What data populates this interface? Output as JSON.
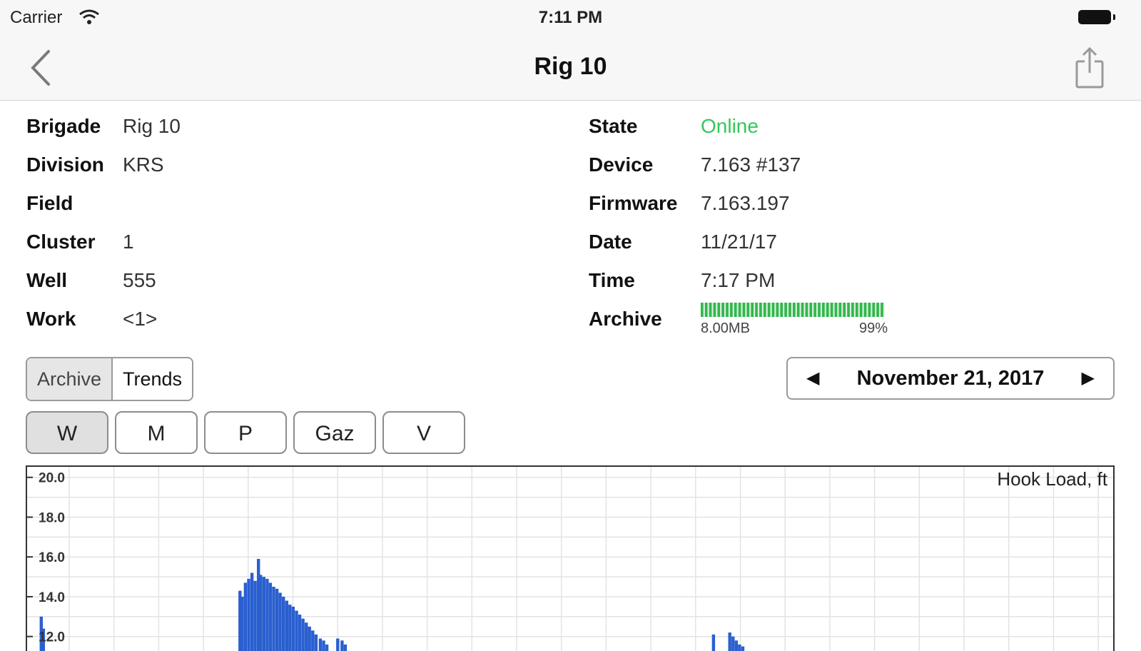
{
  "status_bar": {
    "carrier": "Carrier",
    "time": "7:11 PM",
    "icons": [
      "wifi-icon",
      "battery-icon"
    ]
  },
  "nav": {
    "title": "Rig 10",
    "icons": [
      "chevron-left-icon",
      "share-icon"
    ]
  },
  "info_left": [
    {
      "label": "Brigade",
      "value": "Rig 10"
    },
    {
      "label": "Division",
      "value": "KRS"
    },
    {
      "label": "Field",
      "value": ""
    },
    {
      "label": "Cluster",
      "value": "1"
    },
    {
      "label": "Well",
      "value": "555"
    },
    {
      "label": "Work",
      "value": "<1>"
    }
  ],
  "info_right": [
    {
      "label": "State",
      "value": "Online"
    },
    {
      "label": "Device",
      "value": "7.163 #137"
    },
    {
      "label": "Firmware",
      "value": "7.163.197"
    },
    {
      "label": "Date",
      "value": "11/21/17"
    },
    {
      "label": "Time",
      "value": "7:17 PM"
    },
    {
      "label": "Archive",
      "value": ""
    }
  ],
  "archive": {
    "size": "8.00MB",
    "percent_label": "99%",
    "fill_fraction": 0.99
  },
  "colors": {
    "online": "#34c759",
    "archive_bar": "#2fb84a",
    "series": "#2a5fd0"
  },
  "mode_segment": [
    "Archive",
    "Trends"
  ],
  "date_picker": {
    "date": "November 21, 2017",
    "prev": "◀",
    "next": "▶"
  },
  "filters": [
    "W",
    "M",
    "P",
    "Gaz",
    "V"
  ],
  "chart_data": {
    "type": "bar",
    "title": "Hook Load, ft",
    "ylim": [
      11.2,
      20.6
    ],
    "yticks": [
      "20.0",
      "18.0",
      "16.0",
      "14.0",
      "12.0"
    ],
    "grid": true,
    "x_range": [
      0,
      100
    ],
    "bars": [
      {
        "x": 1.3,
        "y": 13.0
      },
      {
        "x": 1.5,
        "y": 12.4
      },
      {
        "x": 19.6,
        "y": 14.3
      },
      {
        "x": 19.8,
        "y": 14.0
      },
      {
        "x": 20.1,
        "y": 14.7
      },
      {
        "x": 20.4,
        "y": 14.9
      },
      {
        "x": 20.7,
        "y": 15.2
      },
      {
        "x": 21.0,
        "y": 14.8
      },
      {
        "x": 21.3,
        "y": 15.9
      },
      {
        "x": 21.5,
        "y": 15.1
      },
      {
        "x": 21.8,
        "y": 15.0
      },
      {
        "x": 22.1,
        "y": 14.9
      },
      {
        "x": 22.4,
        "y": 14.7
      },
      {
        "x": 22.7,
        "y": 14.5
      },
      {
        "x": 23.0,
        "y": 14.4
      },
      {
        "x": 23.3,
        "y": 14.2
      },
      {
        "x": 23.6,
        "y": 14.0
      },
      {
        "x": 23.9,
        "y": 13.8
      },
      {
        "x": 24.2,
        "y": 13.6
      },
      {
        "x": 24.5,
        "y": 13.5
      },
      {
        "x": 24.8,
        "y": 13.3
      },
      {
        "x": 25.1,
        "y": 13.1
      },
      {
        "x": 25.4,
        "y": 12.9
      },
      {
        "x": 25.7,
        "y": 12.7
      },
      {
        "x": 26.0,
        "y": 12.5
      },
      {
        "x": 26.3,
        "y": 12.3
      },
      {
        "x": 26.6,
        "y": 12.1
      },
      {
        "x": 27.0,
        "y": 11.9
      },
      {
        "x": 27.3,
        "y": 11.8
      },
      {
        "x": 27.6,
        "y": 11.6
      },
      {
        "x": 28.6,
        "y": 11.9
      },
      {
        "x": 29.0,
        "y": 11.8
      },
      {
        "x": 29.3,
        "y": 11.6
      },
      {
        "x": 63.2,
        "y": 12.1
      },
      {
        "x": 64.7,
        "y": 12.2
      },
      {
        "x": 65.0,
        "y": 12.0
      },
      {
        "x": 65.3,
        "y": 11.8
      },
      {
        "x": 65.6,
        "y": 11.6
      },
      {
        "x": 65.9,
        "y": 11.5
      }
    ]
  }
}
